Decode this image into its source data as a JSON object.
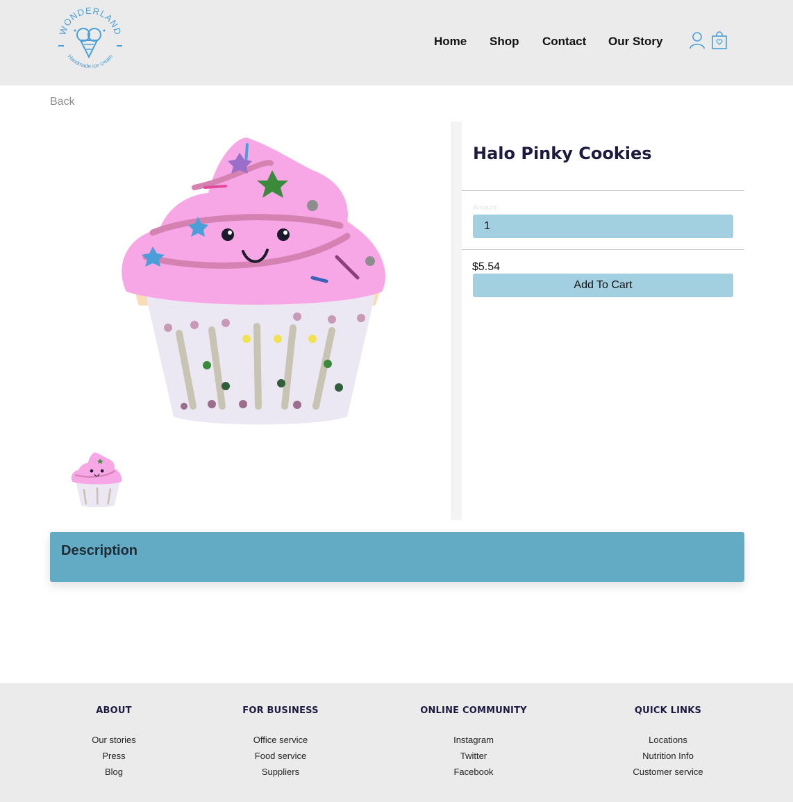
{
  "brand": {
    "name": "WONDERLAND",
    "tagline": "Handmade ice cream",
    "color": "#4a9fd8"
  },
  "nav": {
    "items": [
      "Home",
      "Shop",
      "Contact",
      "Our Story"
    ],
    "icons": [
      "user-icon",
      "shopping-bag-icon"
    ]
  },
  "back_label": "Back",
  "product": {
    "title": "Halo Pinky Cookies",
    "amount_label": "Amount",
    "amount_value": "1",
    "price": "$5.54",
    "add_to_cart_label": "Add To Cart"
  },
  "description": {
    "title": "Description"
  },
  "colors": {
    "header_bg": "#ebebeb",
    "button_bg": "#a2d0e1",
    "description_bg": "#63aac4",
    "title_color": "#1c1a3f"
  },
  "footer": {
    "columns": [
      {
        "heading": "ABOUT",
        "links": [
          "Our stories",
          "Press",
          "Blog"
        ]
      },
      {
        "heading": "FOR BUSINESS",
        "links": [
          "Office service",
          "Food service",
          "Suppliers"
        ]
      },
      {
        "heading": "ONLINE COMMUNITY",
        "links": [
          "Instagram",
          "Twitter",
          "Facebook"
        ]
      },
      {
        "heading": "QUICK LINKS",
        "links": [
          "Locations",
          "Nutrition Info",
          "Customer service"
        ]
      }
    ]
  }
}
